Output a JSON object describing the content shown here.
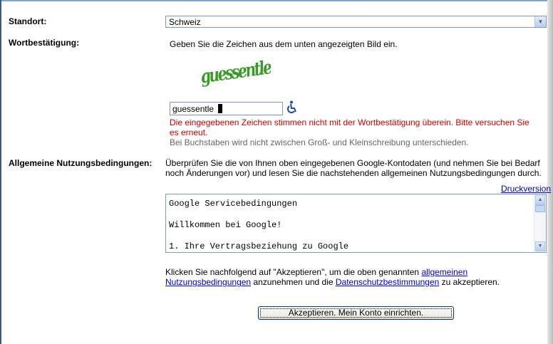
{
  "location": {
    "label": "Standort:",
    "selected": "Schweiz"
  },
  "captcha": {
    "label": "Wortbestätigung:",
    "instruction": "Geben Sie die Zeichen aus dem unten angezeigten Bild ein.",
    "image_text": "guessentle",
    "input_value": "guessentle",
    "error_line1": "Die eingegebenen Zeichen stimmen nicht mit der Wortbestätigung überein. Bitte versuchen Sie",
    "error_line2": "es erneut.",
    "hint": "Bei Buchstaben wird nicht zwischen Groß- und Kleinschreibung unterschieden."
  },
  "terms": {
    "label": "Allgemeine Nutzungsbedingungen:",
    "intro_line1": "Überprüfen Sie die von Ihnen oben eingegebenen Google-Kontodaten (und nehmen Sie bei Bedarf",
    "intro_line2": "noch Änderungen vor) und lesen Sie die nachstehenden allgemeinen Nutzungsbedingungen durch.",
    "print_link": "Druckversion",
    "box_lines": [
      "Google Servicebedingungen",
      "Willkommen bei Google!",
      "1. Ihre Vertragsbeziehung zu Google"
    ]
  },
  "accept": {
    "text_before": "Klicken Sie nachfolgend auf \"Akzeptieren\", um die oben genannten ",
    "link_terms_part1": "allgemeinen",
    "link_terms_part2": "Nutzungsbedingungen",
    "text_middle": " anzunehmen und die ",
    "link_privacy": "Datenschutzbestimmungen",
    "text_after": " zu akzeptieren.",
    "button_label": "Akzeptieren. Mein Konto einrichten."
  },
  "colors": {
    "error": "#cc0000",
    "link": "#0000cc",
    "captcha_green": "#3a9a2a"
  },
  "icons": {
    "dropdown": "chevron-down-icon",
    "accessibility": "wheelchair-icon",
    "scroll_up": "arrow-up-icon",
    "scroll_down": "arrow-down-icon"
  }
}
